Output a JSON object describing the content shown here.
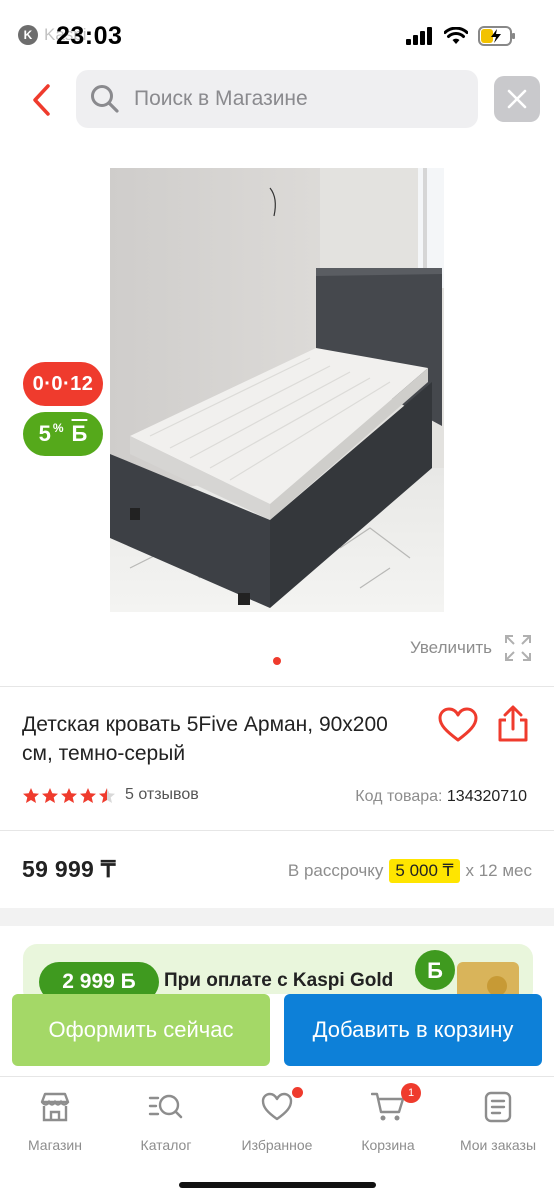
{
  "status_bar": {
    "back_app": "Kaspi",
    "time": "23:03"
  },
  "search": {
    "placeholder": "Поиск в Магазине"
  },
  "badges": {
    "installment": "0·0·12",
    "bonus_percent": "5",
    "bonus_percent_sign": "%",
    "bonus_currency": "Б"
  },
  "gallery": {
    "zoom_label": "Увеличить",
    "current_slide": 1,
    "total_slides": 1
  },
  "product": {
    "title": "Детская кровать 5Five Арман, 90x200 см, темно-серый",
    "rating": 4.5,
    "rating_max": 5,
    "reviews": "5 отзывов",
    "code_label": "Код товара:",
    "code": "134320710",
    "price": "59 999 ₸",
    "installment_label": "В рассрочку",
    "installment_amount": "5 000 ₸",
    "installment_term": "х 12 мес"
  },
  "promo": {
    "badge": "2 999 Б",
    "text": "При оплате с Kaspi Gold"
  },
  "actions": {
    "buy_now": "Оформить сейчас",
    "add_to_cart": "Добавить в корзину"
  },
  "tabbar": {
    "items": [
      {
        "label": "Магазин",
        "icon": "shop-icon"
      },
      {
        "label": "Каталог",
        "icon": "catalog-icon"
      },
      {
        "label": "Избранное",
        "icon": "heart-icon",
        "dot": true
      },
      {
        "label": "Корзина",
        "icon": "cart-icon",
        "badge": "1"
      },
      {
        "label": "Мои заказы",
        "icon": "orders-icon"
      }
    ]
  },
  "colors": {
    "accent_red": "#ef3b2d",
    "bonus_green": "#55a91b",
    "buy_green": "#a4d867",
    "cart_blue": "#0d80d8",
    "installment_yellow": "#ffe500"
  }
}
